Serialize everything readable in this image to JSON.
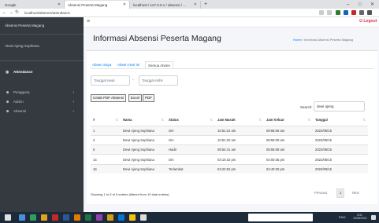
{
  "browser": {
    "tabs": [
      "Google",
      "Absensi Peserta Magang",
      "localhost / 127.0.0.1 / absensi / ..."
    ],
    "new_tab": "+",
    "url": "localhost/absensi/attendance",
    "window_controls": [
      "–",
      "□",
      "✕"
    ]
  },
  "sidebar": {
    "brand": "Absensi Peserta Magang",
    "user": "Dewi Ajeng Sophiana",
    "items": [
      {
        "label": "Attendance",
        "icon": "attendance-icon"
      },
      {
        "label": "Pengguna",
        "icon": "users-icon"
      },
      {
        "label": "Admin",
        "icon": "admin-icon"
      },
      {
        "label": "Absensi",
        "icon": "absensi-icon"
      }
    ]
  },
  "topbar": {
    "logout": "Logout"
  },
  "page": {
    "title": "Informasi Absensi Peserta Magang",
    "breadcrumb_home": "Home",
    "breadcrumb_sep": "/",
    "breadcrumb_current": "Informasi Absensi Peserta Magang"
  },
  "tabs": [
    "Absen Saya",
    "Absen Hari Ini",
    "Semua Absen"
  ],
  "filters": {
    "start_placeholder": "Tanggal Awal",
    "end_placeholder": "Tanggal Akhir",
    "dash": "-"
  },
  "buttons": {
    "pdf_all": "Cetak PDF Absensi",
    "excel": "Excel",
    "pdf": "PDF"
  },
  "search": {
    "label": "Search:",
    "value": "dewi ajeng"
  },
  "table": {
    "headers": [
      "#",
      "Nama",
      "Status",
      "Jam Masuk",
      "Jam Keluar",
      "Tanggal"
    ],
    "rows": [
      [
        "1",
        "Dewi Ajeng Sophiana",
        "Izin",
        "10:51:24 am",
        "08:55:06 am",
        "2022/08/15"
      ],
      [
        "2",
        "Dewi Ajeng Sophiana",
        "Izin",
        "10:51:20 am",
        "08:55:09 am",
        "2022/08/15"
      ],
      [
        "5",
        "Dewi Ajeng Sophiana",
        "Hadir",
        "08:54:41 am",
        "08:55:08 am",
        "2022/08/15"
      ],
      [
        "14",
        "Dewi Ajeng Sophiana",
        "Izin",
        "03:10:32 pm",
        "04:00:35 pm",
        "2022/08/15"
      ],
      [
        "16",
        "Dewi Ajeng Sophiana",
        "Terlambat",
        "04:22:53 pm",
        "04:40:30 pm",
        "2022/08/15"
      ]
    ]
  },
  "footer": {
    "info": "Showing 1 to 5 of 5 entries (filtered from 19 total entries)",
    "previous": "Previous",
    "page": "1",
    "next": "Next"
  },
  "taskbar": {
    "tray": "ENG",
    "time": "8:51",
    "date": "15/08/2022"
  }
}
